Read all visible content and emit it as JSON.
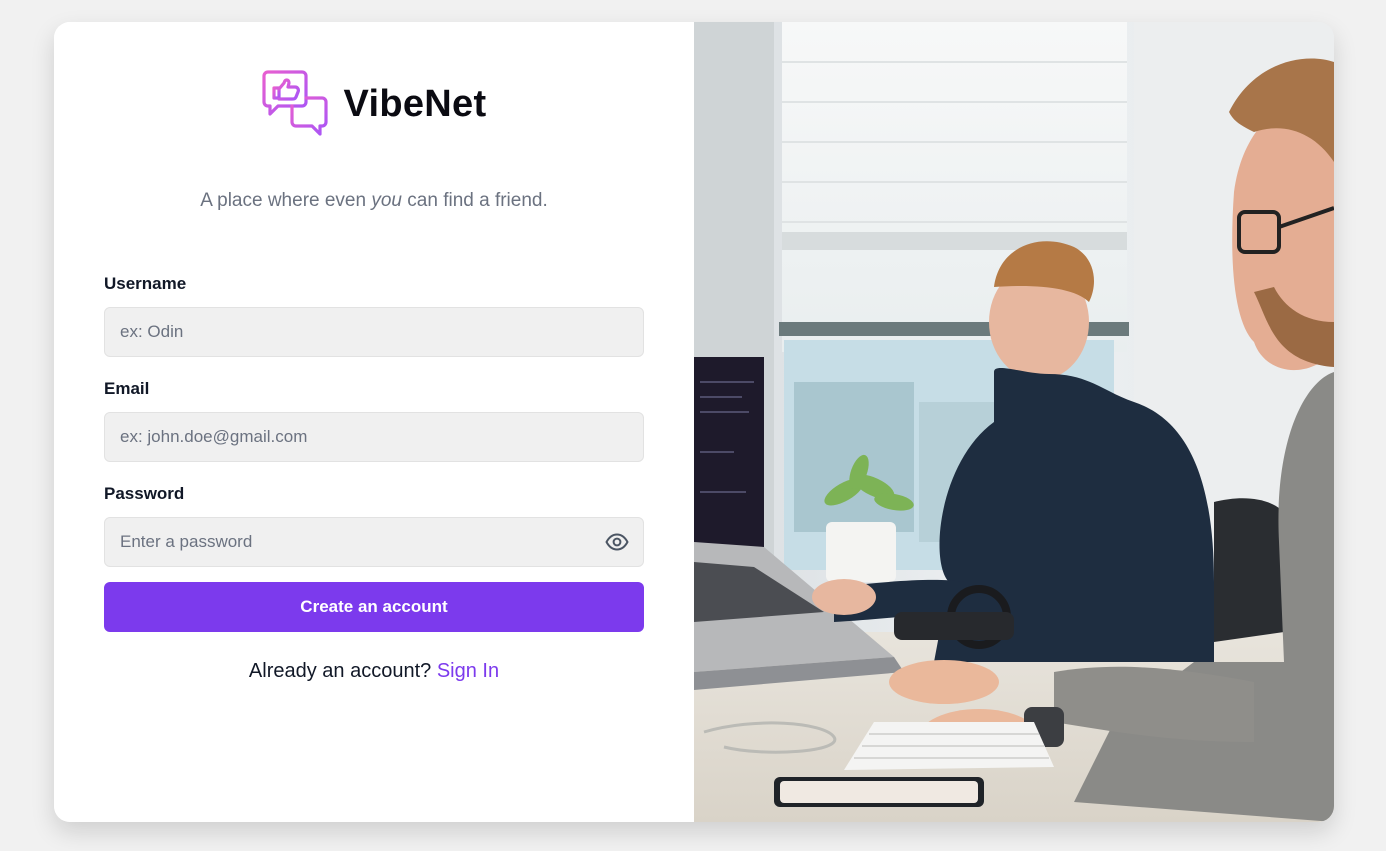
{
  "brand": {
    "name": "VibeNet",
    "logo_icon": "chat-bubbles-thumbs-up-icon"
  },
  "tagline": {
    "before": "A place where even ",
    "emphasis": "you",
    "after": " can find a friend."
  },
  "form": {
    "username": {
      "label": "Username",
      "placeholder": "ex: Odin",
      "value": ""
    },
    "email": {
      "label": "Email",
      "placeholder": "ex: john.doe@gmail.com",
      "value": ""
    },
    "password": {
      "label": "Password",
      "placeholder": "Enter a password",
      "value": "",
      "toggle_icon": "eye-icon"
    },
    "submit_label": "Create an account"
  },
  "signin": {
    "prompt": "Already an account?",
    "link_label": "Sign In"
  },
  "hero_image": {
    "icon": "office-photo"
  },
  "colors": {
    "accent": "#7c3aed",
    "page_background": "#f1f1f1",
    "input_background": "#f0f0f0",
    "logo_gradient_start": "#e85fd0",
    "logo_gradient_end": "#a855f7"
  }
}
